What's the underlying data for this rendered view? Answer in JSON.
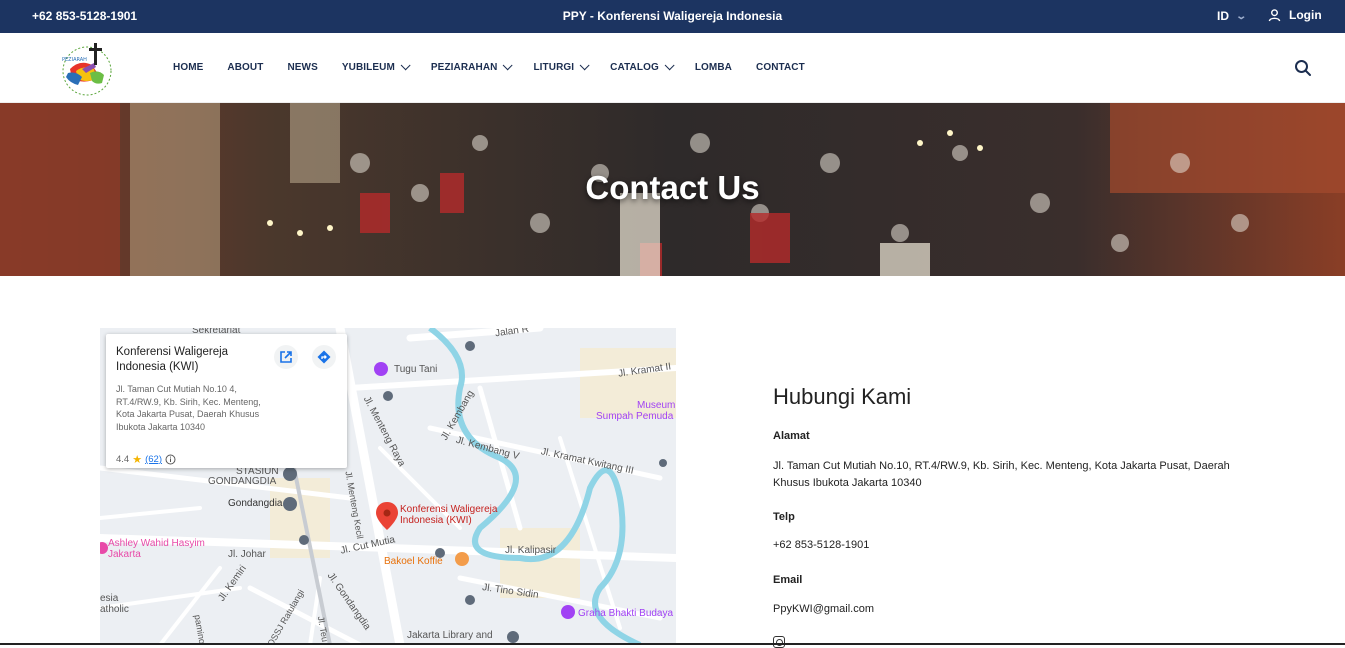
{
  "topbar": {
    "phone": "+62 853-5128-1901",
    "site_title": "PPY - Konferensi Waligereja Indonesia",
    "language": "ID",
    "login": "Login"
  },
  "nav": {
    "items": [
      {
        "label": "HOME",
        "dropdown": false
      },
      {
        "label": "ABOUT",
        "dropdown": false
      },
      {
        "label": "NEWS",
        "dropdown": false
      },
      {
        "label": "YUBILEUM",
        "dropdown": true
      },
      {
        "label": "PEZIARAHAN",
        "dropdown": true
      },
      {
        "label": "LITURGI",
        "dropdown": true
      },
      {
        "label": "CATALOG",
        "dropdown": true
      },
      {
        "label": "LOMBA",
        "dropdown": false
      },
      {
        "label": "CONTACT",
        "dropdown": false
      }
    ]
  },
  "hero": {
    "title": "Contact Us"
  },
  "map": {
    "place_name": "Konferensi Waligereja Indonesia (KWI)",
    "place_address": "Jl. Taman Cut Mutiah No.10 4, RT.4/RW.9, Kb. Sirih, Kec. Menteng, Kota Jakarta Pusat, Daerah Khusus Ibukota Jakarta 10340",
    "rating": "4.4",
    "review_count": "(62)",
    "labels": {
      "sekretariat": "Sekretariat",
      "jalan": "Jalan R",
      "tugu_tani": "Tugu Tani",
      "kramat2": "Jl. Kramat II",
      "museum": "Museum",
      "sumpah_pemuda": "Sumpah Pemuda",
      "kembang": "Jl. Kembang",
      "menteng_raya": "Jl. Menteng Raya",
      "kembang_v": "Jl. Kembang V",
      "kramat_kwitang": "Jl. Kramat Kwitang III",
      "stasiun": "STASIUN",
      "gondangdia_station": "GONDANGDIA",
      "gondangdia": "Gondangdia",
      "menteng_kecil": "Jl. Menteng Kecil",
      "pin": "Konferensi Waligereja Indonesia (KWI)",
      "ashley": "Ashley Wahid Hasyim Jakarta",
      "johar": "Jl. Johar",
      "cut_mutia": "Jl. Cut Mutia",
      "kalipasir": "Jl. Kalipasir",
      "bakoel": "Bakoel Koffie",
      "kemiri": "Jl. Kemiri",
      "gondangdia_jl": "Jl. Gondangdia",
      "tino_sidin": "Jl. Tino Sidin",
      "graha": "Graha Bhakti Budaya",
      "esia": "esia",
      "atholic": "atholic",
      "ratulangi": "Jl. OSSJ Ratulangi",
      "library": "Jakarta Library and",
      "paminoto": "paminoto",
      "tea": "Jl. Teu"
    }
  },
  "contact": {
    "heading": "Hubungi Kami",
    "address_label": "Alamat",
    "address": "Jl. Taman Cut Mutiah No.10, RT.4/RW.9, Kb. Sirih, Kec. Menteng, Kota Jakarta Pusat, Daerah Khusus Ibukota Jakarta 10340",
    "phone_label": "Telp",
    "phone": "+62 853-5128-1901",
    "email_label": "Email",
    "email": "PpyKWI@gmail.com"
  },
  "colors": {
    "topbar": "#1c3461",
    "nav_text": "#1c2e50",
    "map_road": "#ffffff",
    "map_water": "#8fd4e6",
    "map_pin": "#ea4335"
  }
}
